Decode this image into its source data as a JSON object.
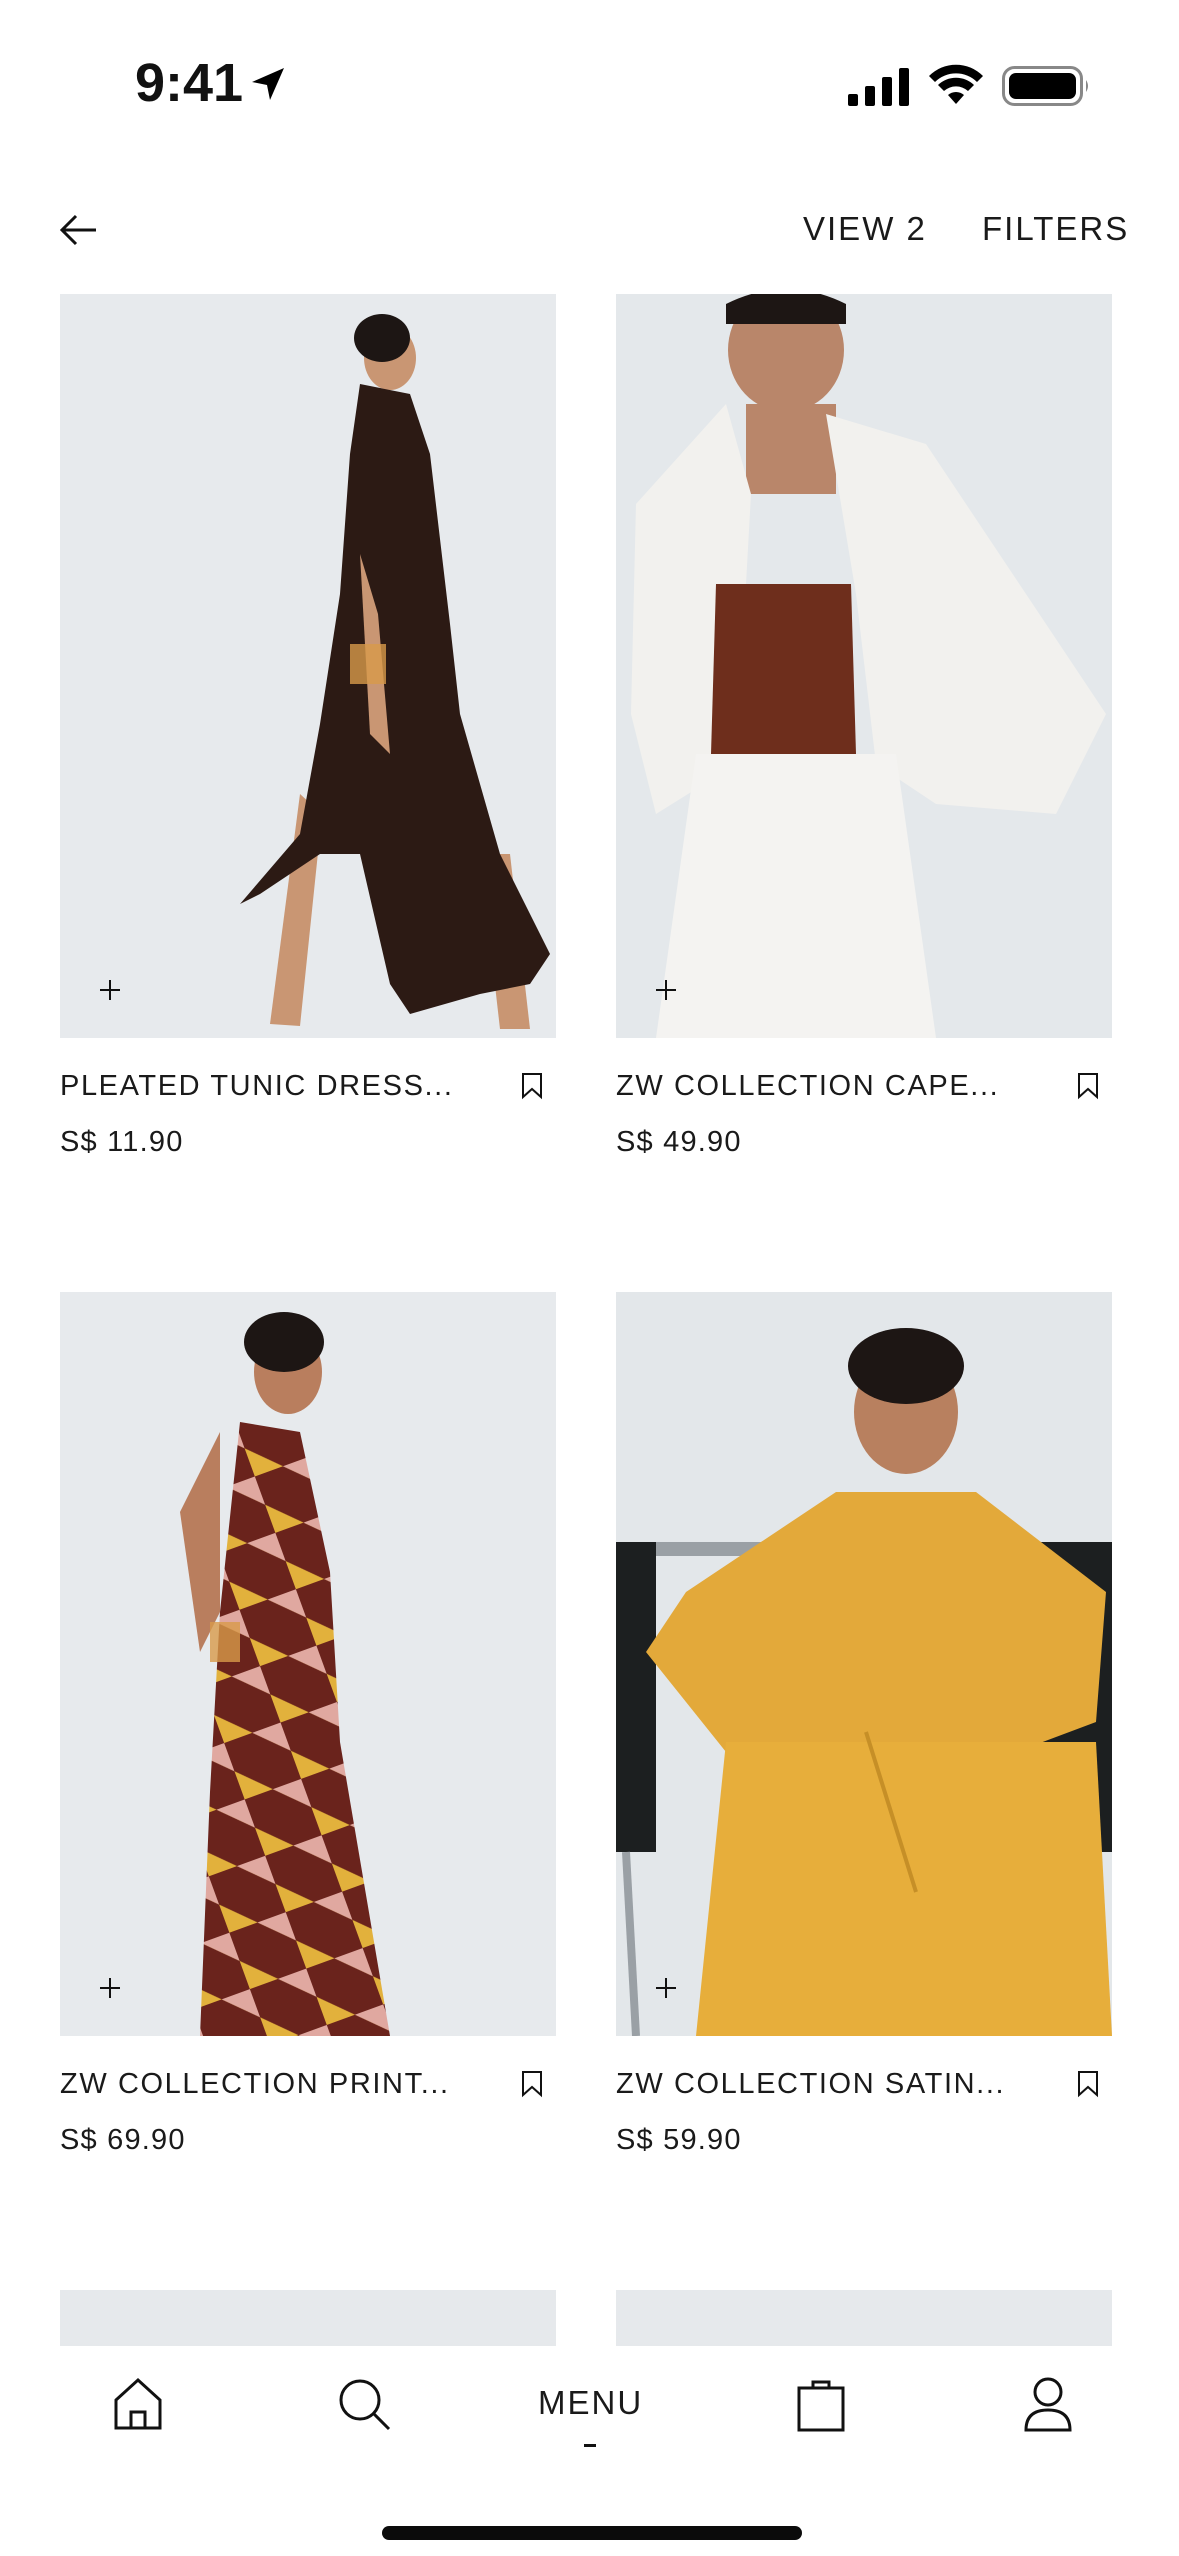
{
  "status_bar": {
    "time": "9:41"
  },
  "header": {
    "view_label": "VIEW 2",
    "filters_label": "FILTERS"
  },
  "products": [
    {
      "title": "PLEATED TUNIC DRESS...",
      "price": "S$ 11.90"
    },
    {
      "title": "ZW COLLECTION CAPE...",
      "price": "S$ 49.90"
    },
    {
      "title": "ZW COLLECTION PRINT...",
      "price": "S$ 69.90"
    },
    {
      "title": "ZW COLLECTION SATIN...",
      "price": "S$ 59.90"
    }
  ],
  "bottom_nav": {
    "menu_label": "MENU",
    "items": [
      "home-icon",
      "search-icon",
      "menu",
      "bag-icon",
      "account-icon"
    ]
  },
  "colors": {
    "photo_background": "#e6e9ec",
    "text": "#1a1a1a",
    "background": "#ffffff"
  }
}
